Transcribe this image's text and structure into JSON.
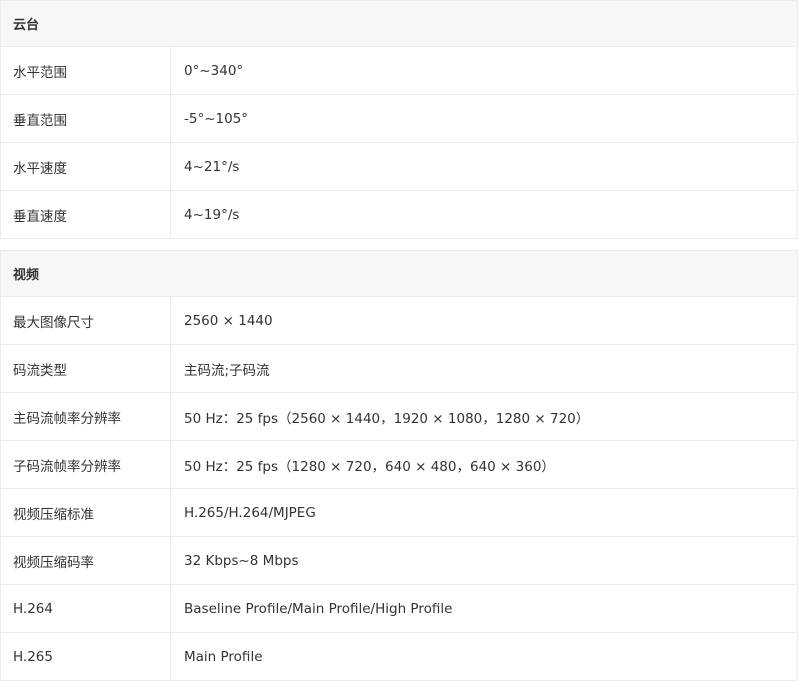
{
  "sections": [
    {
      "title": "云台",
      "rows": [
        {
          "label": "水平范围",
          "value": "0°~340°"
        },
        {
          "label": "垂直范围",
          "value": "-5°~105°"
        },
        {
          "label": "水平速度",
          "value": "4~21°/s"
        },
        {
          "label": "垂直速度",
          "value": "4~19°/s"
        }
      ]
    },
    {
      "title": "视频",
      "rows": [
        {
          "label": "最大图像尺寸",
          "value": "2560 × 1440"
        },
        {
          "label": "码流类型",
          "value": "主码流;子码流"
        },
        {
          "label": "主码流帧率分辨率",
          "value": "50 Hz：25 fps（2560 × 1440，1920 × 1080，1280 × 720）"
        },
        {
          "label": "子码流帧率分辨率",
          "value": "50 Hz：25 fps（1280 × 720，640 × 480，640 × 360）"
        },
        {
          "label": "视频压缩标准",
          "value": "H.265/H.264/MJPEG"
        },
        {
          "label": "视频压缩码率",
          "value": "32 Kbps~8 Mbps"
        },
        {
          "label": "H.264",
          "value": "Baseline Profile/Main Profile/High Profile"
        },
        {
          "label": "H.265",
          "value": "Main Profile"
        }
      ]
    }
  ]
}
